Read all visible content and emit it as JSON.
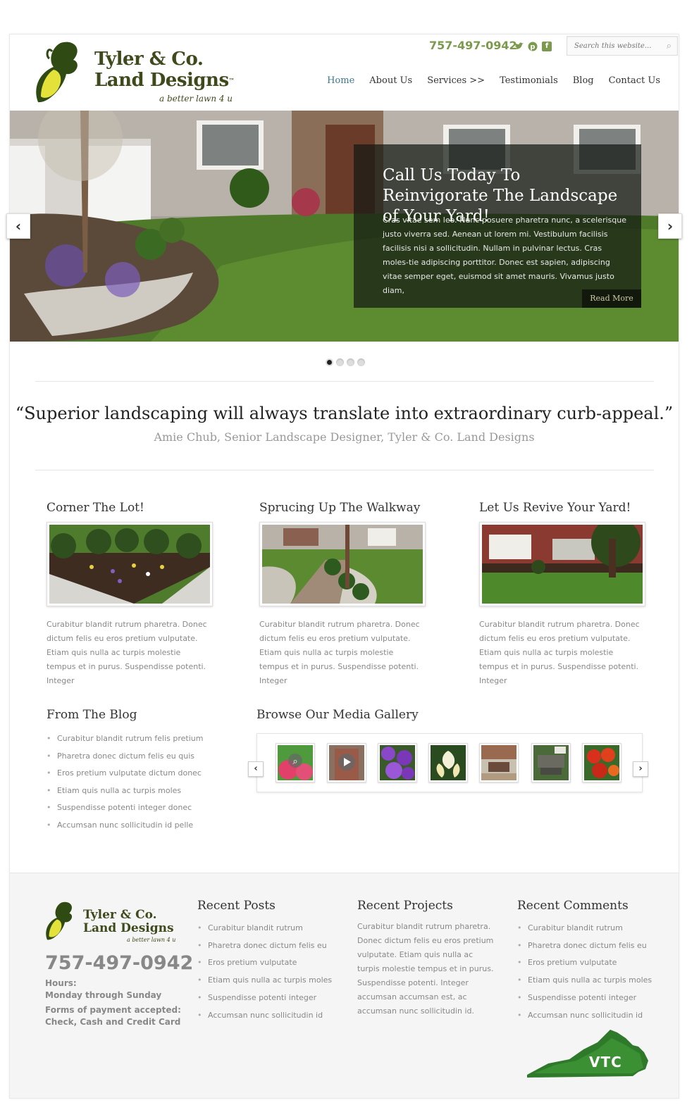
{
  "brand": {
    "title_line1": "Tyler & Co.",
    "title_line2": "Land Designs",
    "trademark": "™",
    "tagline": "a better lawn 4 u",
    "brand_green": "#3f4a1c",
    "accent_green": "#7b9a4d"
  },
  "header": {
    "phone": "757-497-0942",
    "social_icons": [
      "twitter-icon",
      "pinterest-icon",
      "facebook-icon"
    ],
    "search_placeholder": "Search this website..."
  },
  "nav": {
    "items": [
      {
        "label": "Home",
        "active": true
      },
      {
        "label": "About Us",
        "active": false
      },
      {
        "label": "Services >>",
        "active": false
      },
      {
        "label": "Testimonials",
        "active": false
      },
      {
        "label": "Blog",
        "active": false
      },
      {
        "label": "Contact Us",
        "active": false
      }
    ]
  },
  "slider": {
    "heading": "Call Us Today To Reinvigorate The Landscape of Your Yard!",
    "body": "Cras vitae sem leo. Nunc posuere pharetra nunc, a scelerisque justo viverra sed. Aenean ut lorem mi. Vestibulum facilisis facilisis nisi a sollicitudin. Nullam in pulvinar lectus. Cras moles-tie adipiscing porttitor. Donec est sapien, adipiscing vitae semper eget, euismod sit amet mauris. Vivamus justo diam,",
    "read_more": "Read More",
    "prev_arrow": "‹",
    "next_arrow": "›",
    "dots": 4,
    "active_dot": 0
  },
  "quote": {
    "text": "“Superior landscaping will always translate into extraordinary curb-appeal.”",
    "author": "Amie Chub, Senior Landscape Designer, Tyler & Co. Land Designs"
  },
  "features": [
    {
      "title": "Corner The Lot!",
      "text": "Curabitur blandit rutrum pharetra. Donec dictum felis eu eros pretium vulputate. Etiam quis nulla ac turpis molestie tempus et in purus. Suspendisse potenti. Integer"
    },
    {
      "title": "Sprucing Up The Walkway",
      "text": "Curabitur blandit rutrum pharetra. Donec dictum felis eu eros pretium vulputate. Etiam quis nulla ac turpis molestie tempus et in purus. Suspendisse potenti. Integer"
    },
    {
      "title": "Let Us Revive Your Yard!",
      "text": "Curabitur blandit rutrum pharetra. Donec dictum felis eu eros pretium vulputate. Etiam quis nulla ac turpis molestie tempus et in purus. Suspendisse potenti. Integer"
    }
  ],
  "blog": {
    "title": "From The Blog",
    "items": [
      "Curabitur blandit rutrum felis pretium",
      "Pharetra donec dictum felis eu quis",
      "Eros pretium vulputate dictum donec",
      "Etiam quis nulla ac turpis moles",
      "Suspendisse potenti integer donec",
      "Accumsan nunc sollicitudin id pelle"
    ]
  },
  "gallery": {
    "title": "Browse Our Media Gallery",
    "prev_arrow": "‹",
    "next_arrow": "›",
    "thumbs": [
      "flower-zoom-thumb",
      "video-play-thumb",
      "purple-flowers-thumb",
      "white-iris-thumb",
      "patio-thumb",
      "outdoor-furniture-thumb",
      "tomatoes-thumb"
    ]
  },
  "footer": {
    "phone": "757-497-0942",
    "hours_label": "Hours:",
    "hours_value": "Monday through Sunday",
    "payment_label": "Forms of payment accepted:",
    "payment_value": "Check, Cash and Credit Card",
    "recent_posts": {
      "title": "Recent Posts",
      "items": [
        "Curabitur blandit rutrum",
        "Pharetra donec dictum felis eu",
        "Eros pretium vulputate",
        "Etiam quis nulla ac turpis moles",
        "Suspendisse potenti integer",
        "Accumsan nunc sollicitudin id"
      ]
    },
    "recent_projects": {
      "title": "Recent Projects",
      "text": "Curabitur blandit rutrum pharetra. Donec dictum felis eu eros pretium vulputate. Etiam quis nulla ac turpis molestie tempus et in purus. Suspendisse potenti. Integer accumsan accumsan est, ac accumsan nunc sollicitudin id."
    },
    "recent_comments": {
      "title": "Recent Comments",
      "items": [
        "Curabitur blandit rutrum",
        "Pharetra donec dictum felis eu",
        "Eros pretium vulputate",
        "Etiam quis nulla ac turpis moles",
        "Suspendisse potenti integer",
        "Accumsan nunc sollicitudin id"
      ]
    },
    "badge_text": "VTC"
  }
}
